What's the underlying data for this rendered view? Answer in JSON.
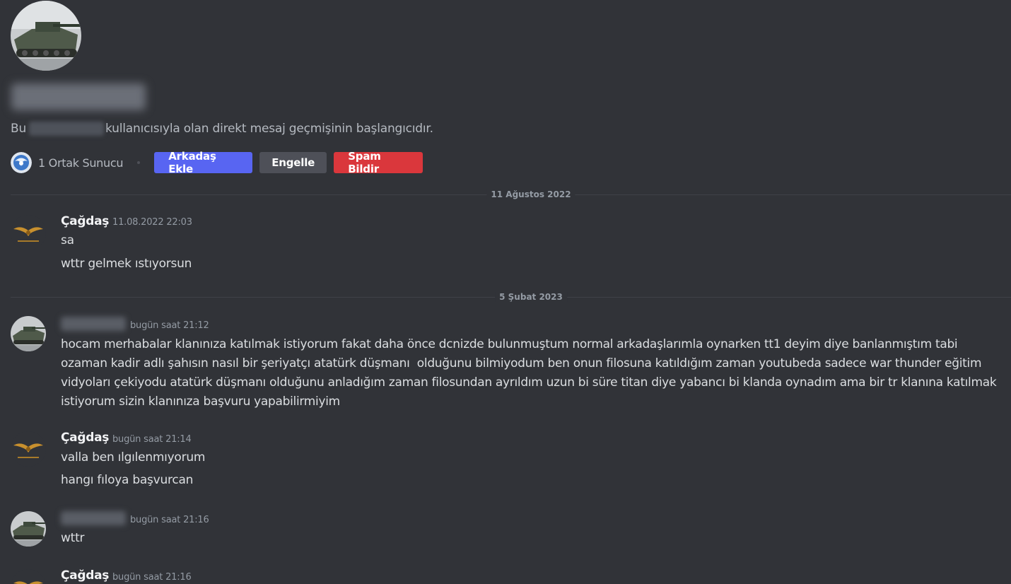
{
  "header": {
    "description_before": "Bu",
    "description_after": "kullanıcısıyla olan direkt mesaj geçmişinin başlangıcıdır.",
    "mutual_servers": "1 Ortak Sunucu",
    "add_friend_label": "Arkadaş Ekle",
    "block_label": "Engelle",
    "report_spam_label": "Spam Bildir"
  },
  "dividers": [
    "11 Ağustos 2022",
    "5 Şubat 2023"
  ],
  "messages": [
    {
      "author": "Çağdaş",
      "timestamp": "11.08.2022 22:03",
      "lines": [
        "sa",
        "wttr gelmek ıstıyorsun"
      ]
    },
    {
      "author": "",
      "timestamp": "bugün saat 21:12",
      "text": "hocam merhabalar klanınıza katılmak istiyorum fakat daha önce dcnizde bulunmuştum normal arkadaşlarımla oynarken tt1 deyim diye banlanmıştım tabi\nozaman kadir adlı şahısın nasıl bir şeriyatçı atatürk düşmanı  olduğunu bilmiyodum ben onun filosuna katıldığım zaman youtubeda sadece war thunder eğitim\nvidyoları çekiyodu atatürk düşmanı olduğunu anladığım zaman filosundan ayrıldım uzun bi süre titan diye yabancı bi klanda oynadım ama bir tr klanına katılmak\nistiyorum sizin klanınıza başvuru yapabilirmiyim"
    },
    {
      "author": "Çağdaş",
      "timestamp": "bugün saat 21:14",
      "lines": [
        "valla ben ılgılenmıyorum",
        "hangı fıloya başvurcan"
      ]
    },
    {
      "author": "",
      "timestamp": "bugün saat 21:16",
      "lines": [
        "wttr"
      ]
    },
    {
      "author": "Çağdaş",
      "timestamp": "bugün saat 21:16",
      "lines": []
    }
  ],
  "colors": {
    "background": "#313338",
    "brand": "#5865f2",
    "danger": "#da373c",
    "secondary": "#4e5058"
  }
}
